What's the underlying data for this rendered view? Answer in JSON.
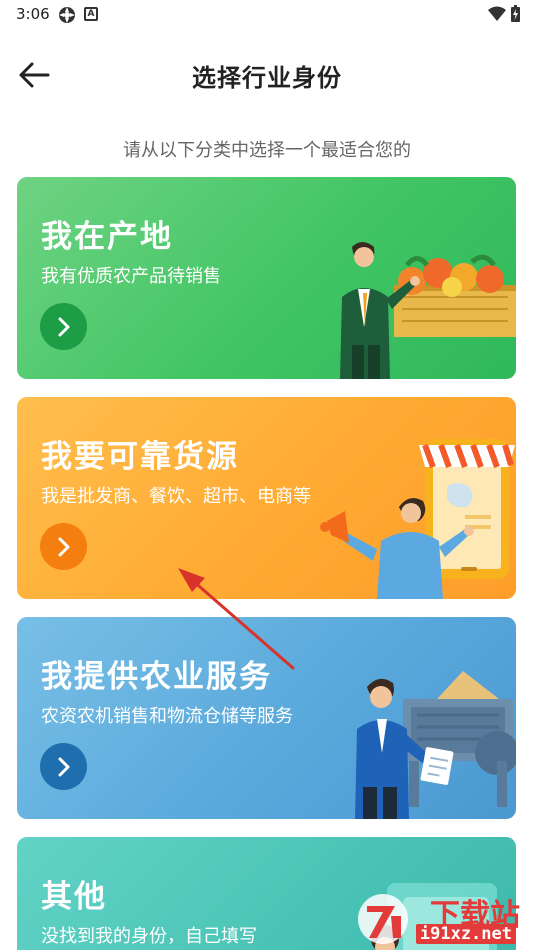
{
  "status_bar": {
    "time": "3:06",
    "icons": [
      "gear-icon",
      "a-badge-icon",
      "wifi-icon",
      "battery-charging-icon"
    ]
  },
  "header": {
    "title": "选择行业身份",
    "back_icon": "arrow-left-icon"
  },
  "subtitle": "请从以下分类中选择一个最适合您的",
  "cards": [
    {
      "title": "我在产地",
      "desc": "我有优质农产品待销售",
      "color": "#41c564",
      "icon": "chevron-right-icon"
    },
    {
      "title": "我要可靠货源",
      "desc": "我是批发商、餐饮、超市、电商等",
      "color": "#ffaa32",
      "icon": "chevron-right-icon"
    },
    {
      "title": "我提供农业服务",
      "desc": "农资农机销售和物流仓储等服务",
      "color": "#5aa9dc",
      "icon": "chevron-right-icon"
    },
    {
      "title": "其他",
      "desc": "没找到我的身份，自己填写",
      "color": "#49c3b5"
    }
  ],
  "watermark": {
    "top_text": "下载站",
    "bottom_text": "i91xz.net",
    "accent": "#e33a3a"
  },
  "annotation": {
    "arrow_color": "#d8332b"
  }
}
